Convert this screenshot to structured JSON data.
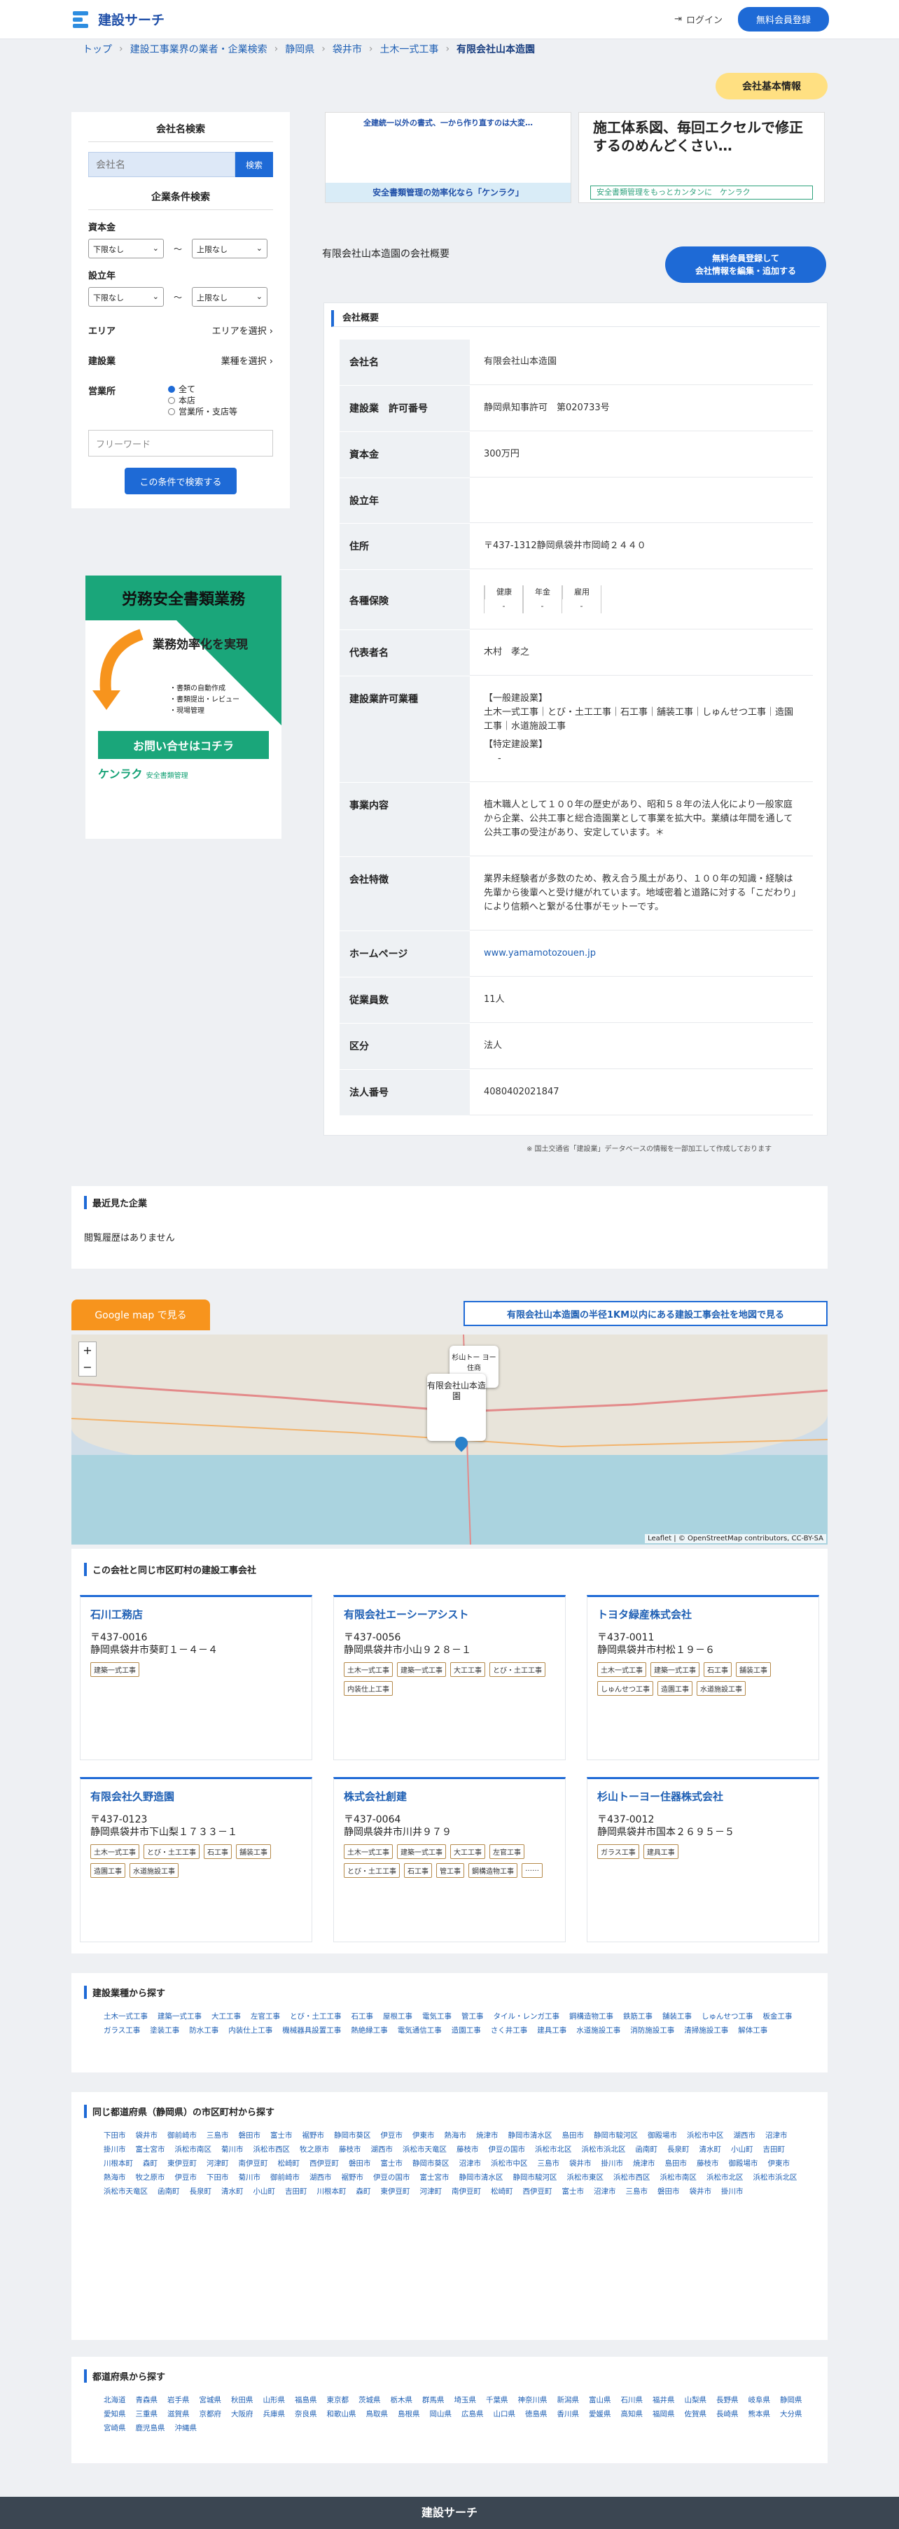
{
  "header": {
    "logo": "建設サーチ",
    "login": "ログイン",
    "register": "無料会員登録"
  },
  "breadcrumb": [
    "トップ",
    "建設工事業界の業者・企業検索",
    "静岡県",
    "袋井市",
    "土木一式工事",
    "有限会社山本造園"
  ],
  "badge": "会社基本情報",
  "sidebar": {
    "title": "会社名検索",
    "search_placeholder": "会社名",
    "search_btn": "検索",
    "cond_title": "企業条件検索",
    "capital": "資本金",
    "year": "設立年",
    "lower": "下限なし",
    "upper": "上限なし",
    "tilde": "〜",
    "area": "エリア",
    "area_sel": "エリアを選択",
    "industry": "建設業",
    "industry_sel": "業種を選択",
    "office": "営業所",
    "office_opts": [
      "全て",
      "本店",
      "営業所・支店等"
    ],
    "freeword": "フリーワード",
    "submit": "この条件で検索する"
  },
  "side_ad": {
    "top": "労務安全書類業務",
    "task": "業務効率化を実現",
    "items": [
      "・書類の自動作成",
      "・書類提出・レビュー",
      "・現場管理"
    ],
    "cta": "お問い合せはコチラ",
    "brand": "ケンラク",
    "sub": "安全書類管理"
  },
  "ad1": {
    "t": "全建統一以外の書式、一から作り直すのは大変…",
    "b": "安全書類管理の効率化なら「ケンラク」"
  },
  "ad2": {
    "t": "施工体系図、毎回エクセルで修正するのめんどくさい…",
    "b": "安全書類管理をもっとカンタンに　ケンラク"
  },
  "overview_heading": "有限会社山本造園の会社概要",
  "edit_btn1": "無料会員登録して",
  "edit_btn2": "会社情報を編集・追加する",
  "card_title": "会社概要",
  "rows": {
    "name_k": "会社名",
    "name": "有限会社山本造園",
    "lic_k": "建設業　許可番号",
    "lic": "静岡県知事許可　第020733号",
    "cap_k": "資本金",
    "cap": "300万円",
    "est_k": "設立年",
    "est": "",
    "addr_k": "住所",
    "addr": "〒437-1312静岡県袋井市岡崎２４４０",
    "ins_k": "各種保険",
    "ins": [
      "健康",
      "年金",
      "雇用"
    ],
    "ins_v": "-",
    "rep_k": "代表者名",
    "rep": "木村　孝之",
    "perm_k": "建設業許可業種",
    "perm1": "【一般建設業】",
    "perm2": "土木一式工事｜とび・土工工事｜石工事｜舗装工事｜しゅんせつ工事｜造園工事｜水道施設工事",
    "perm3": "【特定建設業】",
    "perm4": "-",
    "biz_k": "事業内容",
    "biz": "植木職人として１００年の歴史があり、昭和５８年の法人化により一般家庭から企業、公共工事と総合造園業として事業を拡大中。業績は年間を通して公共工事の受注があり、安定しています。＊",
    "feat_k": "会社特徴",
    "feat": "業界未経験者が多数のため、教え合う風土があり、１００年の知識・経験は先輩から後輩へと受け継がれています。地域密着と道路に対する「こだわり」により信頼へと繋がる仕事がモットーです。",
    "hp_k": "ホームページ",
    "hp": "www.yamamotozouen.jp",
    "emp_k": "従業員数",
    "emp": "11人",
    "kind_k": "区分",
    "kind": "法人",
    "corp_k": "法人番号",
    "corp": "4080402021847"
  },
  "note": "※ 国土交通省「建設業」データベースの情報を一部加工して作成しております",
  "recent": {
    "title": "最近見た企業",
    "empty": "閲覧履歴はありません"
  },
  "map": {
    "gmap": "Google map で見る",
    "link": "有限会社山本造園の半径1KM以内にある建設工事会社を地図で見る",
    "pop": "有限会社山本造園",
    "pop2": "杉山トー ヨー住商",
    "attr": "Leaflet | © OpenStreetMap contributors, CC-BY-SA"
  },
  "same_title": "この会社と同じ市区町村の建設工事会社",
  "companies": [
    {
      "n": "石川工務店",
      "z": "〒437-0016",
      "a": "静岡県袋井市葵町１－４－４",
      "tags": [
        "建築一式工事"
      ]
    },
    {
      "n": "有限会社エーシーアシスト",
      "z": "〒437-0056",
      "a": "静岡県袋井市小山９２８－１",
      "tags": [
        "土木一式工事",
        "建築一式工事",
        "大工工事",
        "とび・土工工事",
        "内装仕上工事"
      ]
    },
    {
      "n": "トヨタ緑産株式会社",
      "z": "〒437-0011",
      "a": "静岡県袋井市村松１９－６",
      "tags": [
        "土木一式工事",
        "建築一式工事",
        "石工事",
        "舗装工事",
        "しゅんせつ工事",
        "造園工事",
        "水道施設工事"
      ]
    },
    {
      "n": "有限会社久野造園",
      "z": "〒437-0123",
      "a": "静岡県袋井市下山梨１７３３－１",
      "tags": [
        "土木一式工事",
        "とび・土工工事",
        "石工事",
        "舗装工事",
        "造園工事",
        "水道施設工事"
      ]
    },
    {
      "n": "株式会社創建",
      "z": "〒437-0064",
      "a": "静岡県袋井市川井９７９",
      "tags": [
        "土木一式工事",
        "建築一式工事",
        "大工工事",
        "左官工事",
        "とび・土工工事",
        "石工事",
        "管工事",
        "鋼構造物工事",
        "……"
      ]
    },
    {
      "n": "杉山トーヨー住器株式会社",
      "z": "〒437-0012",
      "a": "静岡県袋井市国本２６９５－５",
      "tags": [
        "ガラス工事",
        "建具工事"
      ]
    }
  ],
  "industry_title": "建設業種から探す",
  "industries": [
    "土木一式工事",
    "建築一式工事",
    "大工工事",
    "左官工事",
    "とび・土工工事",
    "石工事",
    "屋根工事",
    "電気工事",
    "管工事",
    "タイル・レンガ工事",
    "鋼構造物工事",
    "鉄筋工事",
    "舗装工事",
    "しゅんせつ工事",
    "板金工事",
    "ガラス工事",
    "塗装工事",
    "防水工事",
    "内装仕上工事",
    "機械器具設置工事",
    "熱絶縁工事",
    "電気通信工事",
    "造園工事",
    "さく井工事",
    "建具工事",
    "水道施設工事",
    "消防施設工事",
    "清掃施設工事",
    "解体工事"
  ],
  "city_title": "同じ都道府県（静岡県）の市区町村から探す",
  "cities": [
    "下田市",
    "袋井市",
    "御前崎市",
    "三島市",
    "磐田市",
    "富士市",
    "裾野市",
    "静岡市葵区",
    "伊豆市",
    "伊東市",
    "熱海市",
    "焼津市",
    "静岡市清水区",
    "島田市",
    "静岡市駿河区",
    "御殿場市",
    "浜松市中区",
    "湖西市",
    "沼津市",
    "掛川市",
    "富士宮市",
    "浜松市南区",
    "菊川市",
    "浜松市西区",
    "牧之原市",
    "藤枝市",
    "湖西市",
    "浜松市天竜区",
    "藤枝市",
    "伊豆の国市",
    "浜松市北区",
    "浜松市浜北区",
    "函南町",
    "長泉町",
    "清水町",
    "小山町",
    "吉田町",
    "川根本町",
    "森町",
    "東伊豆町",
    "河津町",
    "南伊豆町",
    "松崎町",
    "西伊豆町",
    "磐田市",
    "富士市",
    "静岡市葵区",
    "沼津市",
    "浜松市中区",
    "三島市",
    "袋井市",
    "掛川市",
    "焼津市",
    "島田市",
    "藤枝市",
    "御殿場市",
    "伊東市",
    "熱海市",
    "牧之原市",
    "伊豆市",
    "下田市",
    "菊川市",
    "御前崎市",
    "湖西市",
    "裾野市",
    "伊豆の国市",
    "富士宮市",
    "静岡市清水区",
    "静岡市駿河区",
    "浜松市東区",
    "浜松市西区",
    "浜松市南区",
    "浜松市北区",
    "浜松市浜北区",
    "浜松市天竜区",
    "函南町",
    "長泉町",
    "清水町",
    "小山町",
    "吉田町",
    "川根本町",
    "森町",
    "東伊豆町",
    "河津町",
    "南伊豆町",
    "松崎町",
    "西伊豆町",
    "富士市",
    "沼津市",
    "三島市",
    "磐田市",
    "袋井市",
    "掛川市"
  ],
  "pref_title": "都道府県から探す",
  "prefs": [
    "北海道",
    "青森県",
    "岩手県",
    "宮城県",
    "秋田県",
    "山形県",
    "福島県",
    "東京都",
    "茨城県",
    "栃木県",
    "群馬県",
    "埼玉県",
    "千葉県",
    "神奈川県",
    "新潟県",
    "富山県",
    "石川県",
    "福井県",
    "山梨県",
    "長野県",
    "岐阜県",
    "静岡県",
    "愛知県",
    "三重県",
    "滋賀県",
    "京都府",
    "大阪府",
    "兵庫県",
    "奈良県",
    "和歌山県",
    "鳥取県",
    "島根県",
    "岡山県",
    "広島県",
    "山口県",
    "徳島県",
    "香川県",
    "愛媛県",
    "高知県",
    "福岡県",
    "佐賀県",
    "長崎県",
    "熊本県",
    "大分県",
    "宮崎県",
    "鹿児島県",
    "沖縄県"
  ],
  "footer": "建設サーチ"
}
